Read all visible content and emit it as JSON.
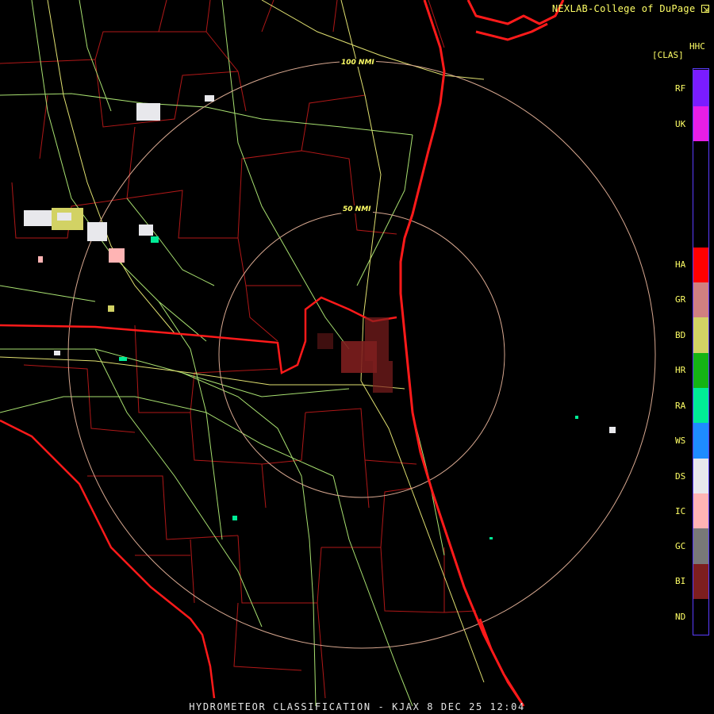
{
  "header": {
    "credit": "NEXLAB-College of DuPage",
    "credit_icon": "external-link-icon",
    "product_code": "HHC",
    "product_abbr": "[CLAS]"
  },
  "footer": {
    "title": "HYDROMETEOR CLASSIFICATION - KJAX 8 DEC 25 12:04"
  },
  "range_rings": [
    {
      "label": "50 NMI"
    },
    {
      "label": "100 NMI"
    }
  ],
  "legend": {
    "border_color": "#5a3cff",
    "classes": [
      {
        "code": "RF",
        "color": "#7a1cff"
      },
      {
        "code": "UK",
        "color": "#e61ee6"
      },
      {
        "code": "HA",
        "color": "#ff0000"
      },
      {
        "code": "GR",
        "color": "#d08080"
      },
      {
        "code": "BD",
        "color": "#d2d264"
      },
      {
        "code": "HR",
        "color": "#14b414"
      },
      {
        "code": "RA",
        "color": "#00ec96"
      },
      {
        "code": "WS",
        "color": "#1e8cff"
      },
      {
        "code": "DS",
        "color": "#e8e8ec"
      },
      {
        "code": "IC",
        "color": "#ffb4b4"
      },
      {
        "code": "GC",
        "color": "#787878"
      },
      {
        "code": "BI",
        "color": "#7d1e1e"
      },
      {
        "code": "ND",
        "color": "#000000"
      }
    ]
  },
  "map_colors": {
    "state_border": "#ff1a1a",
    "county_line": "#b01818",
    "highway": "#a8e070",
    "interstate": "#e0e070",
    "range_ring": "#d8a890"
  }
}
